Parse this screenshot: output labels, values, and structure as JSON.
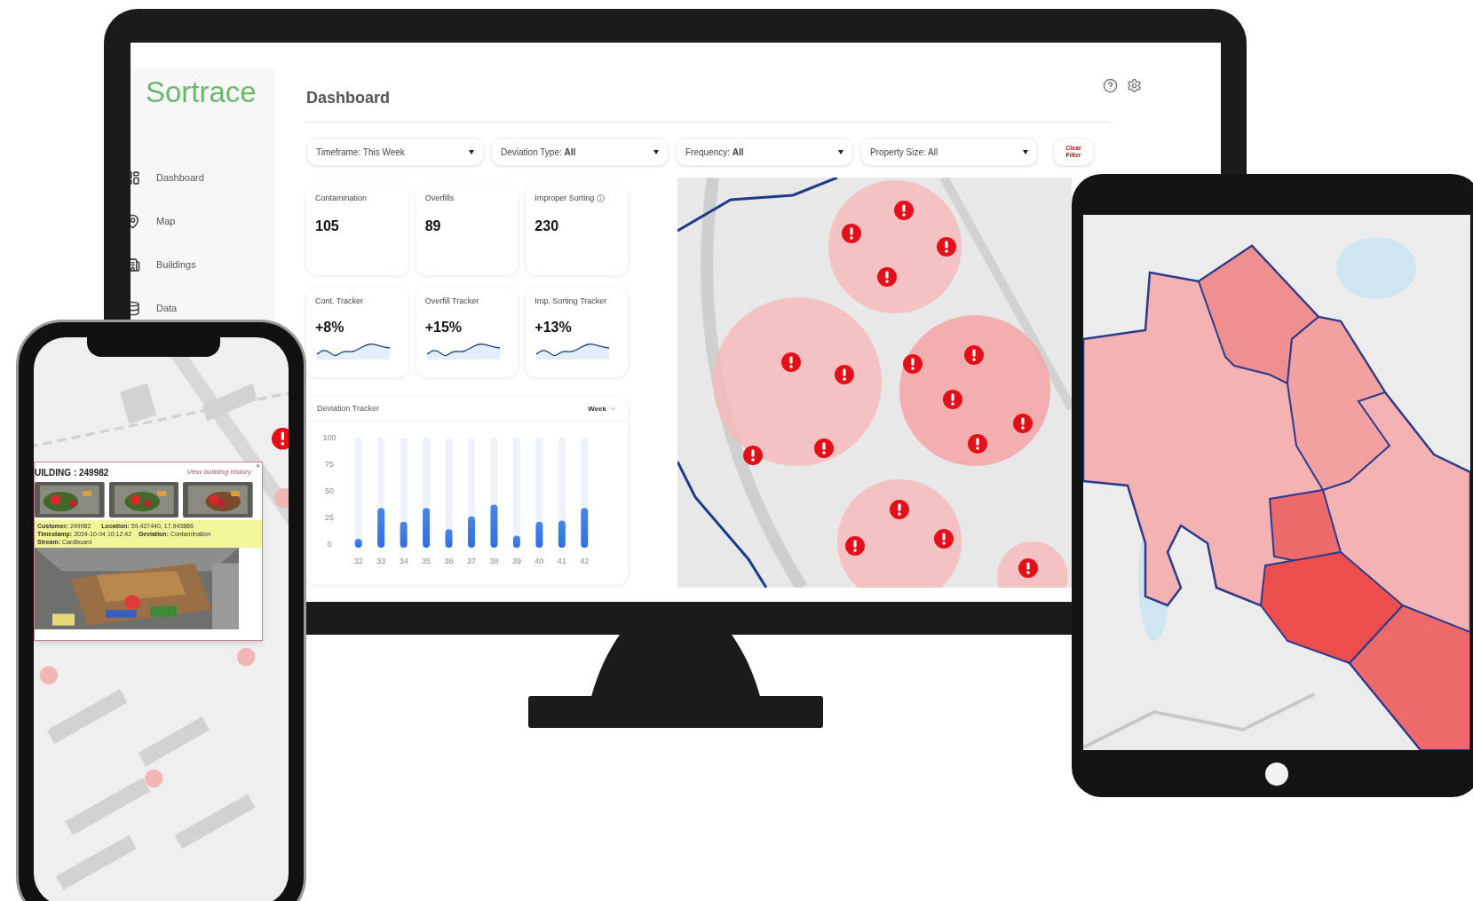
{
  "brand": "Sortrace",
  "sidebar": {
    "items": [
      {
        "label": "Dashboard"
      },
      {
        "label": "Map"
      },
      {
        "label": "Buildings"
      },
      {
        "label": "Data"
      }
    ]
  },
  "page": {
    "title": "Dashboard"
  },
  "filters": [
    {
      "text": "Timeframe: This Week"
    },
    {
      "text": "Deviation Type: **All**"
    },
    {
      "text": "Frequency: **All**"
    },
    {
      "text": "Property Size: All"
    }
  ],
  "clear_filter": "Clear Filter",
  "stats": [
    {
      "label": "Contamination",
      "value": "105",
      "info": false
    },
    {
      "label": "Overfills",
      "value": "89",
      "info": false
    },
    {
      "label": "Improper Sorting",
      "value": "230",
      "info": true
    }
  ],
  "trackers": [
    {
      "label": "Cont. Tracker",
      "value": "+8%"
    },
    {
      "label": "Overfill Tracker",
      "value": "+15%"
    },
    {
      "label": "Imp. Sorting Tracker",
      "value": "+13%"
    }
  ],
  "deviation_tracker": {
    "title": "Deviation Tracker",
    "period": "Week",
    "chart_data": {
      "type": "bar",
      "categories": [
        "32",
        "33",
        "34",
        "35",
        "36",
        "37",
        "38",
        "39",
        "40",
        "41",
        "42"
      ],
      "values": [
        5,
        34,
        21,
        34,
        14,
        26,
        37,
        8,
        21,
        22,
        34
      ],
      "ylim": [
        0,
        100
      ],
      "yticks": [
        0,
        25,
        50,
        75,
        100
      ]
    }
  },
  "phone_popup": {
    "title": "UILDING : 249982",
    "link": "View building history",
    "close": "×",
    "fields": [
      {
        "label": "Customer:",
        "value": "249982"
      },
      {
        "label": "Location:",
        "value": "59.427440, 17.943886"
      },
      {
        "label": "Timestamp:",
        "value": "2024-10-04 10:12:42"
      },
      {
        "label": "Deviation:",
        "value": "Contamination"
      },
      {
        "label": "Stream:",
        "value": "Cardboard"
      }
    ]
  }
}
